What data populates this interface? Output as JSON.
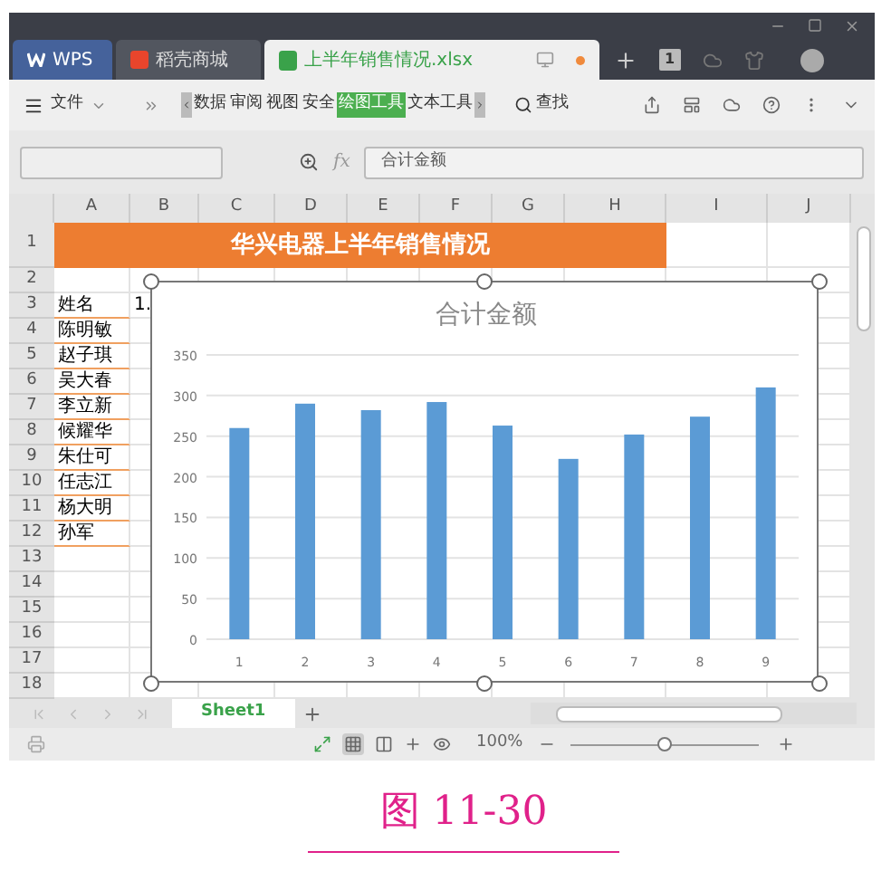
{
  "tabs": [
    {
      "label": "WPS",
      "kind": "home",
      "selected": false
    },
    {
      "label": "稻壳商城",
      "kind": "store",
      "selected": false
    },
    {
      "label": "上半年销售情况.xlsx",
      "kind": "sheet",
      "selected": true
    }
  ],
  "tab_bar_badge": "1",
  "toolbar": {
    "menu": "文件",
    "ribbon_tabs": [
      {
        "label": "数据",
        "selected": false
      },
      {
        "label": "审阅",
        "selected": false
      },
      {
        "label": "视图",
        "selected": false
      },
      {
        "label": "安全",
        "selected": false
      },
      {
        "label": "绘图工具",
        "selected": true
      },
      {
        "label": "文本工具",
        "selected": false
      }
    ],
    "search": "查找"
  },
  "formula_bar": {
    "fx": "fx",
    "value": "合计金额"
  },
  "sheet": {
    "columns": [
      "A",
      "B",
      "C",
      "D",
      "E",
      "F",
      "G",
      "H",
      "I",
      "J"
    ],
    "title": "华兴电器上半年销售情况",
    "rows": [
      {
        "number": "1",
        "kind": "title",
        "cells": []
      },
      {
        "number": "2",
        "kind": "data",
        "cells": []
      },
      {
        "number": "3",
        "kind": "data",
        "cells": [
          "姓名",
          "1."
        ]
      },
      {
        "number": "4",
        "kind": "data",
        "cells": [
          "陈明敏"
        ]
      },
      {
        "number": "5",
        "kind": "data",
        "cells": [
          "赵子琪"
        ]
      },
      {
        "number": "6",
        "kind": "data",
        "cells": [
          "吴大春"
        ]
      },
      {
        "number": "7",
        "kind": "data",
        "cells": [
          "李立新"
        ]
      },
      {
        "number": "8",
        "kind": "data",
        "cells": [
          "候耀华"
        ]
      },
      {
        "number": "9",
        "kind": "data",
        "cells": [
          "朱仕可"
        ]
      },
      {
        "number": "10",
        "kind": "data",
        "cells": [
          "任志江"
        ]
      },
      {
        "number": "11",
        "kind": "data",
        "cells": [
          "杨大明"
        ]
      },
      {
        "number": "12",
        "kind": "data",
        "cells": [
          "孙军"
        ]
      },
      {
        "number": "13",
        "kind": "data",
        "cells": []
      },
      {
        "number": "14",
        "kind": "data",
        "cells": []
      },
      {
        "number": "15",
        "kind": "data",
        "cells": []
      },
      {
        "number": "16",
        "kind": "data",
        "cells": []
      },
      {
        "number": "17",
        "kind": "data",
        "cells": []
      },
      {
        "number": "18",
        "kind": "data",
        "cells": []
      }
    ]
  },
  "chart": {
    "chart_data": {
      "type": "bar",
      "title": "合计金额",
      "categories": [
        "1",
        "2",
        "3",
        "4",
        "5",
        "6",
        "7",
        "8",
        "9"
      ],
      "series": [
        {
          "color": "#5b9bd5",
          "values": [
            260,
            290,
            282,
            292,
            263,
            222,
            252,
            274,
            310
          ]
        }
      ],
      "grid": true,
      "ylim": [
        0,
        350
      ],
      "yticks": [
        0,
        50,
        100,
        150,
        200,
        250,
        300,
        350
      ]
    }
  },
  "sheet_tabs": [
    {
      "label": "Sheet1",
      "selected": true
    }
  ],
  "status_bar": {
    "zoom": "100%",
    "level": 0.5
  },
  "caption": "图 11-30"
}
